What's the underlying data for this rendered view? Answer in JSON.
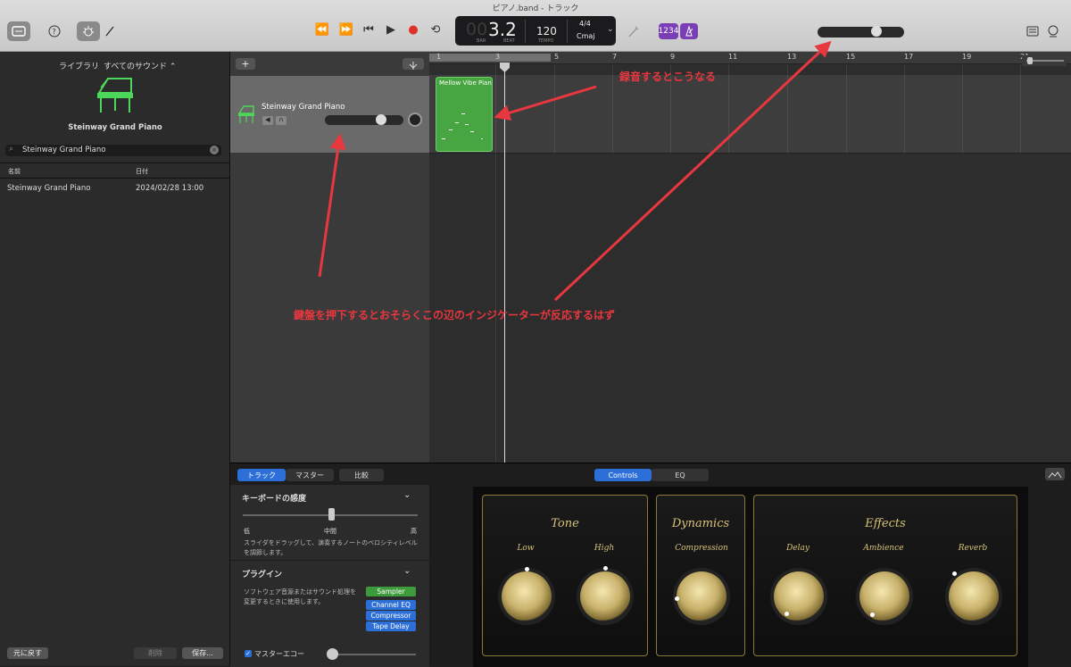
{
  "window": {
    "title": "ピアノ.band - トラック"
  },
  "toolbar": {
    "library_icon": "library-icon",
    "help_icon": "help-icon",
    "smart_controls_icon": "smart-controls-icon",
    "editors_icon": "scissors-icon",
    "transport": {
      "rewind": "⏪",
      "forward": "⏩",
      "to_start": "⏮",
      "play": "▶",
      "record": "●",
      "cycle": "⟲"
    },
    "lcd": {
      "bar_dim": "00",
      "position": "3.2",
      "bar_label": "BAR",
      "beat_label": "BEAT",
      "tempo": "120",
      "tempo_label": "TEMPO",
      "time_sig": "4/4",
      "key": "Cmaj"
    },
    "count_in": "1234",
    "metronome_icon": "metronome-icon",
    "master_volume_level": 0.8,
    "notepad_icon": "notepad-icon",
    "loops_icon": "loops-icon"
  },
  "library": {
    "tab": "ライブラリ",
    "filter": "すべてのサウンド ⌃",
    "instrument_name": "Steinway Grand Piano",
    "search_value": "Steinway Grand Piano",
    "col_name": "名前",
    "col_date": "日付",
    "rows": [
      {
        "name": "Steinway Grand Piano",
        "date": "2024/02/28 13:00"
      }
    ],
    "revert_btn": "元に戻す",
    "delete_btn": "削除",
    "save_btn": "保存..."
  },
  "tracks": {
    "add_btn": "+",
    "track_name": "Steinway Grand Piano",
    "region_name": "Mellow Vibe Pian",
    "ruler": [
      "1",
      "3",
      "5",
      "7",
      "9",
      "11",
      "13",
      "15",
      "17",
      "19",
      "21"
    ]
  },
  "annotations": {
    "top": "録音するとこうなる",
    "middle": "鍵盤を押下するとおそらくこの辺のインジケーターが反応するはず"
  },
  "bottom": {
    "tab_track": "トラック",
    "tab_master": "マスター",
    "tab_compare": "比較",
    "view_controls": "Controls",
    "view_eq": "EQ",
    "keyboard_sensitivity": "キーボードの感度",
    "low": "低",
    "mid": "中間",
    "high": "高",
    "sensitivity_desc": "スライダをドラッグして、演奏するノートのベロシティレベルを調節します。",
    "plugins": "プラグイン",
    "plugins_desc": "ソフトウェア音源またはサウンド処理を変更するときに使用します。",
    "plugin_list": [
      "Sampler",
      "Channel EQ",
      "Compressor",
      "Tape Delay"
    ],
    "master_echo": "マスターエコー",
    "panels": {
      "tone": "Tone",
      "dynamics": "Dynamics",
      "effects": "Effects",
      "low": "Low",
      "high": "High",
      "compression": "Compression",
      "delay": "Delay",
      "ambience": "Ambience",
      "reverb": "Reverb"
    }
  },
  "colors": {
    "accent": "#2d6fd8",
    "region": "#47a642",
    "annotation": "#e8373e",
    "gold": "#d8c27a"
  }
}
